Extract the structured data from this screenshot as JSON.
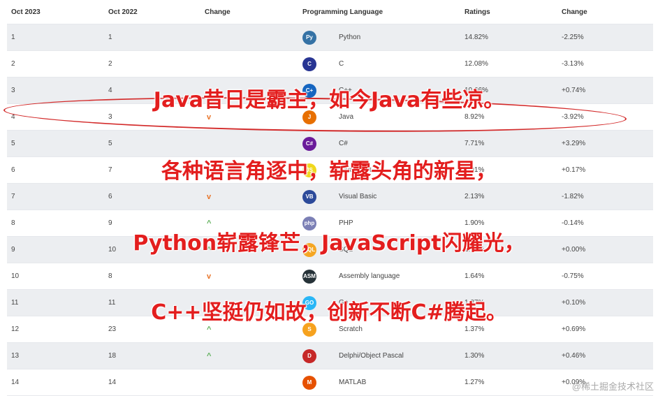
{
  "headers": {
    "current": "Oct 2023",
    "previous": "Oct 2022",
    "change": "Change",
    "language": "Programming Language",
    "ratings": "Ratings",
    "change2": "Change"
  },
  "rows": [
    {
      "current": "1",
      "previous": "1",
      "trend": "",
      "language": "Python",
      "rating": "14.82%",
      "delta": "-2.25%",
      "logo_text": "Py",
      "logo_color": "#3572a5"
    },
    {
      "current": "2",
      "previous": "2",
      "trend": "",
      "language": "C",
      "rating": "12.08%",
      "delta": "-3.13%",
      "logo_text": "C",
      "logo_color": "#283593"
    },
    {
      "current": "3",
      "previous": "4",
      "trend": "",
      "language": "C++",
      "rating": "10.66%",
      "delta": "+0.74%",
      "logo_text": "C+",
      "logo_color": "#1565c0"
    },
    {
      "current": "4",
      "previous": "3",
      "trend": "down",
      "language": "Java",
      "rating": "8.92%",
      "delta": "-3.92%",
      "logo_text": "J",
      "logo_color": "#e76f00"
    },
    {
      "current": "5",
      "previous": "5",
      "trend": "",
      "language": "C#",
      "rating": "7.71%",
      "delta": "+3.29%",
      "logo_text": "C#",
      "logo_color": "#6a1b9a"
    },
    {
      "current": "6",
      "previous": "7",
      "trend": "up",
      "language": "JavaScript",
      "rating": "2.91%",
      "delta": "+0.17%",
      "logo_text": "JS",
      "logo_color": "#f0d81c"
    },
    {
      "current": "7",
      "previous": "6",
      "trend": "down",
      "language": "Visual Basic",
      "rating": "2.13%",
      "delta": "-1.82%",
      "logo_text": "VB",
      "logo_color": "#2c4a9a"
    },
    {
      "current": "8",
      "previous": "9",
      "trend": "up",
      "language": "PHP",
      "rating": "1.90%",
      "delta": "-0.14%",
      "logo_text": "php",
      "logo_color": "#7b7fb5"
    },
    {
      "current": "9",
      "previous": "10",
      "trend": "up",
      "language": "SQL",
      "rating": "1.78%",
      "delta": "+0.00%",
      "logo_text": "SQL",
      "logo_color": "#f5a623"
    },
    {
      "current": "10",
      "previous": "8",
      "trend": "down",
      "language": "Assembly language",
      "rating": "1.64%",
      "delta": "-0.75%",
      "logo_text": "ASM",
      "logo_color": "#263238"
    },
    {
      "current": "11",
      "previous": "11",
      "trend": "",
      "language": "Go",
      "rating": "1.37%",
      "delta": "+0.10%",
      "logo_text": "GO",
      "logo_color": "#29b6f6"
    },
    {
      "current": "12",
      "previous": "23",
      "trend": "up",
      "language": "Scratch",
      "rating": "1.37%",
      "delta": "+0.69%",
      "logo_text": "S",
      "logo_color": "#f6a21e"
    },
    {
      "current": "13",
      "previous": "18",
      "trend": "up",
      "language": "Delphi/Object Pascal",
      "rating": "1.30%",
      "delta": "+0.46%",
      "logo_text": "D",
      "logo_color": "#c62828"
    },
    {
      "current": "14",
      "previous": "14",
      "trend": "",
      "language": "MATLAB",
      "rating": "1.27%",
      "delta": "+0.09%",
      "logo_text": "M",
      "logo_color": "#e65100"
    }
  ],
  "trend_glyphs": {
    "up": "^",
    "down": "v"
  },
  "overlay_lines": [
    "Java昔日是霸主，如今Java有些凉。",
    "各种语言角逐中，崭露头角的新星，",
    "Python崭露锋芒，JavaScript闪耀光，",
    "C++坚挺仍如故，创新不断C#腾起。"
  ],
  "watermark": "@稀土掘金技术社区",
  "colors": {
    "overlay": "#e31e1e",
    "circle": "#d32a2a",
    "down": "#e8752a",
    "up": "#5aad55"
  }
}
